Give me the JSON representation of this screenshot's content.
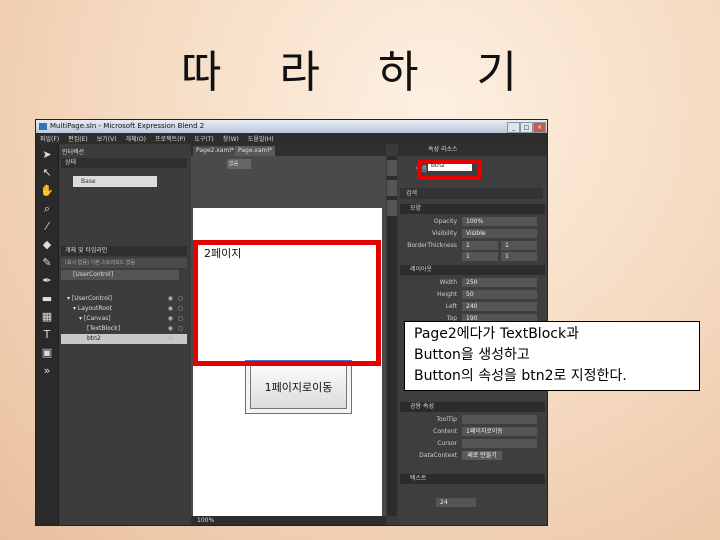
{
  "slide": {
    "title": "따 라 하 기"
  },
  "window": {
    "title": "MultiPage.sln - Microsoft Expression Blend 2"
  },
  "menu": [
    "파일(F)",
    "편집(E)",
    "보기(V)",
    "개체(O)",
    "프로젝트(P)",
    "도구(T)",
    "창(W)",
    "도움말(H)"
  ],
  "left_panel": {
    "tab": "인터랙션",
    "states_label": "상태",
    "base_label": "Base",
    "objects_title": "개체 및 타임라인",
    "search_hint": "(표시 없음) 기본 스토리보드 없음",
    "root": "[UserControl]",
    "tree": [
      {
        "label": "[UserControl]",
        "indent": 1
      },
      {
        "label": "LayoutRoot",
        "indent": 2
      },
      {
        "label": "[Canvas]",
        "indent": 3
      },
      {
        "label": "[TextBlock]",
        "indent": 4
      },
      {
        "label": "btn2",
        "indent": 4,
        "selected": true
      }
    ]
  },
  "doc": {
    "tab1": "Page2.xaml*",
    "tab2": "Page.xaml*",
    "sub_button": "없음",
    "page_text": "2페이지",
    "button_text": "1페이지로이동",
    "zoom": "100%"
  },
  "right_panel": {
    "tabs": "속성   리소스",
    "name_label": "이름",
    "name_value": "btn2",
    "search_hint": "검색",
    "sections": {
      "appearance": "모양",
      "layout": "레이아웃",
      "common": "공용 속성",
      "text": "텍스트"
    },
    "props": {
      "opacity_label": "Opacity",
      "opacity": "100%",
      "visibility_label": "Visibility",
      "visibility": "Visible",
      "border_label": "BorderThickness",
      "b1": "1",
      "b2": "1",
      "b3": "1",
      "b4": "1",
      "width_label": "Width",
      "width": "250",
      "height_label": "Height",
      "height": "50",
      "left_label": "Left",
      "left": "240",
      "top_label": "Top",
      "top": "190",
      "tooltip_label": "ToolTip",
      "content_label": "Content",
      "content": "1페이지로이동",
      "cursor_label": "Cursor",
      "datacontext_label": "DataContext",
      "datacontext": "새로 만들기",
      "font_size": "24"
    }
  },
  "callout": {
    "line1": "Page2에다가 TextBlock과",
    "line2": "Button을 생성하고",
    "line3": "Button의 속성을 btn2로 지정한다."
  }
}
